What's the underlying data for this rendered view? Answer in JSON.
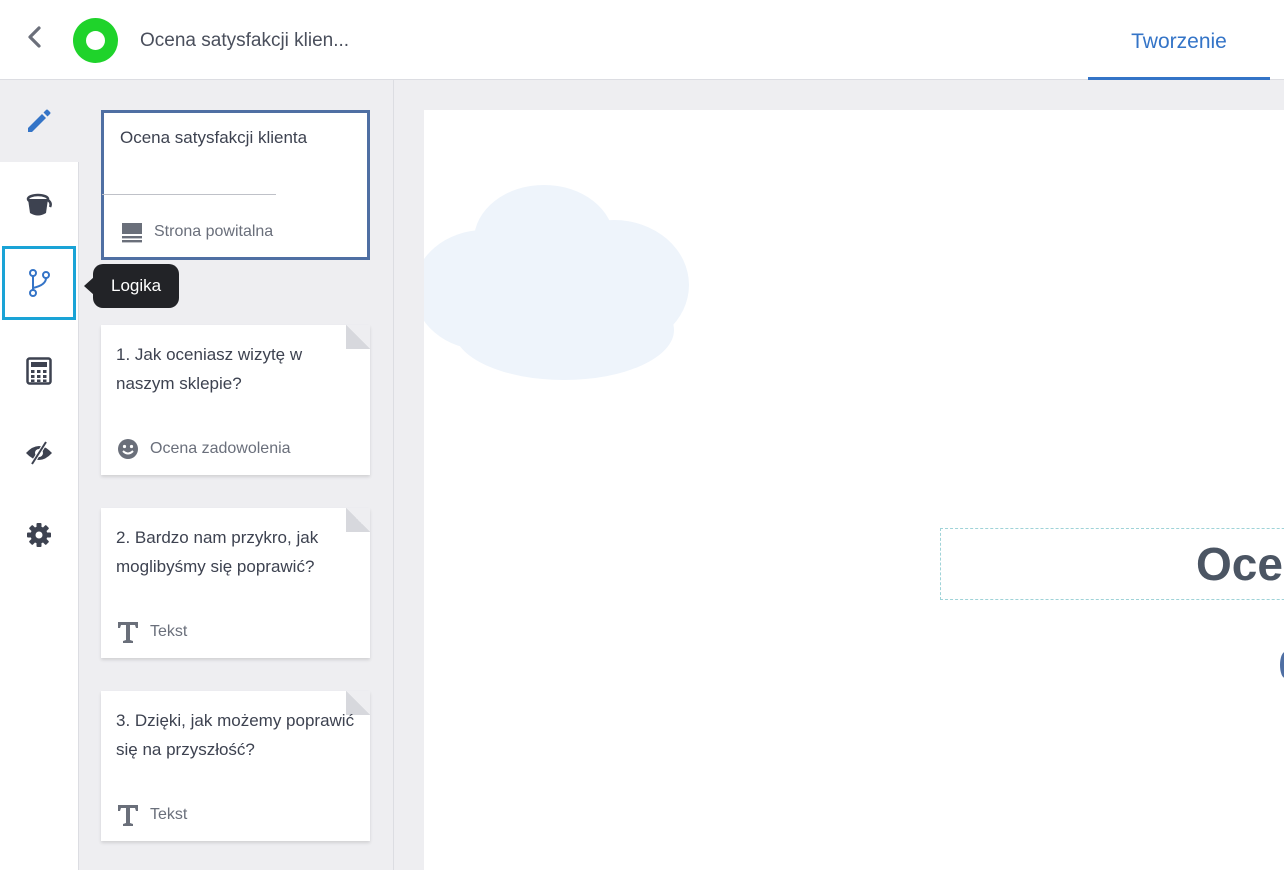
{
  "header": {
    "survey_title": "Ocena satysfakcji klien...",
    "tab_label": "Tworzenie",
    "accent_color": "#3474c7",
    "logo_color": "#1fd32b"
  },
  "rail": {
    "items": [
      {
        "name": "edit",
        "icon": "pencil-icon"
      },
      {
        "name": "paint",
        "icon": "paint-bucket-icon"
      },
      {
        "name": "logic",
        "icon": "branch-icon",
        "active": true
      },
      {
        "name": "calculator",
        "icon": "calculator-icon"
      },
      {
        "name": "visibility",
        "icon": "eye-slash-icon"
      },
      {
        "name": "settings",
        "icon": "gear-icon"
      }
    ],
    "tooltip": "Logika"
  },
  "cards": {
    "welcome": {
      "text": "Ocena satysfakcji klienta",
      "type_label": "Strona powitalna",
      "type_icon": "welcome-page-icon"
    },
    "questions": [
      {
        "text": "1. Jak oceniasz wizytę w naszym sklepie?",
        "type_label": "Ocena zadowolenia",
        "type_icon": "smiley-icon"
      },
      {
        "text": "2. Bardzo nam przykro, jak moglibyśmy się poprawić?",
        "type_label": "Tekst",
        "type_icon": "text-type-icon"
      },
      {
        "text": "3. Dzięki, jak możemy poprawić się na przyszłość?",
        "type_label": "Tekst",
        "type_icon": "text-type-icon"
      }
    ]
  },
  "canvas": {
    "visible_title": "Oce"
  }
}
